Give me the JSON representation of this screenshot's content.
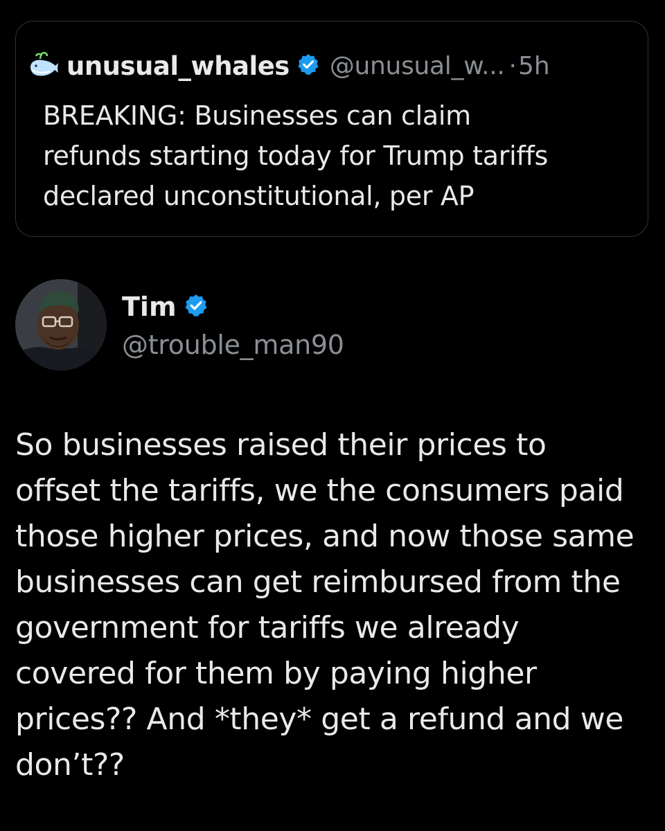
{
  "quoted_tweet": {
    "name": "unusual_whales",
    "handle": "@unusual_w...",
    "separator": "·",
    "time": "5h",
    "text_lines": [
      "BREAKING: Businesses can claim",
      "refunds starting today for Trump tariffs",
      "declared unconstitutional, per AP"
    ],
    "icon": "whale-icon"
  },
  "tweet": {
    "author_name": "Tim",
    "author_handle": "@trouble_man90",
    "verified": true,
    "text_lines": [
      "So businesses raised their prices to",
      "offset the tariffs, we the consumers paid",
      "those higher prices, and now those same",
      "businesses can get reimbursed from the",
      "government for tariffs we already",
      "covered for them by paying higher",
      "prices?? And *they* get a refund and we",
      "don’t??"
    ]
  },
  "colors": {
    "background": "#000000",
    "text_primary": "#e7e9ea",
    "text_secondary": "#8b8f94",
    "border": "#2f3336",
    "verified_blue": "#1d9bf0"
  }
}
